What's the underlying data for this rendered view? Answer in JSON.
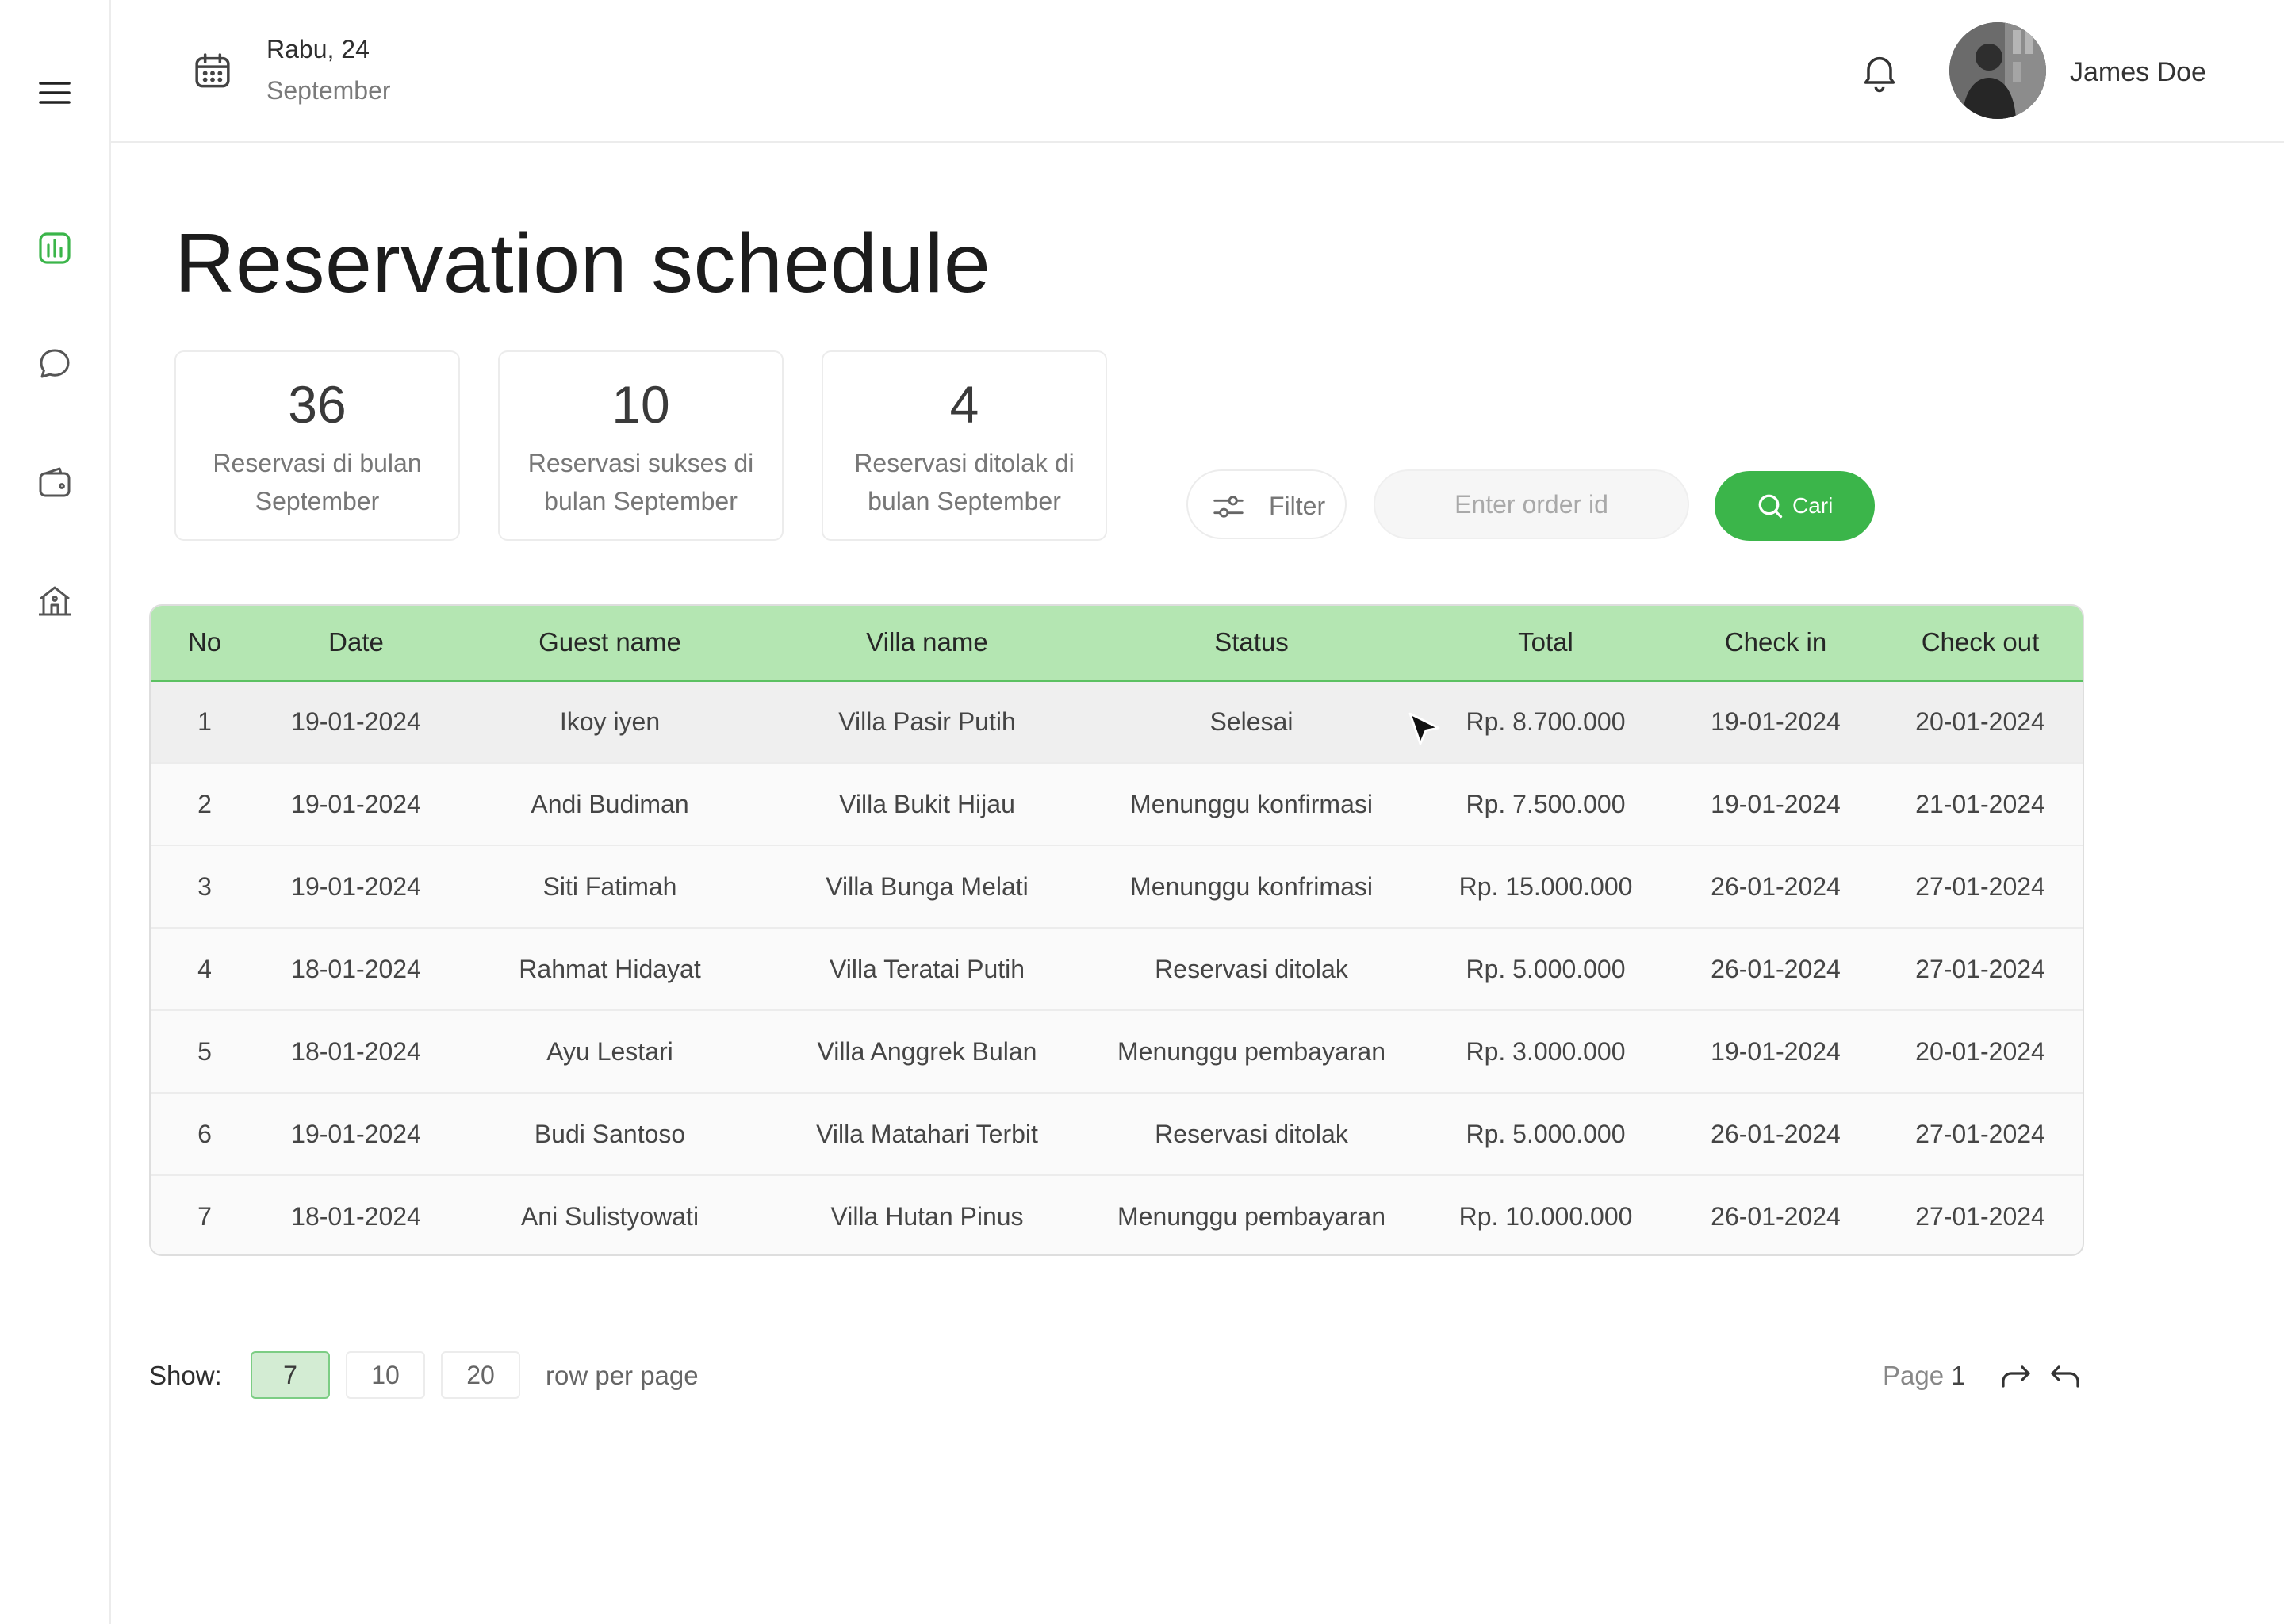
{
  "header": {
    "date_day": "Rabu, 24",
    "date_month": "September",
    "user_name": "James Doe"
  },
  "sidebar": {
    "items": [
      {
        "icon": "menu-icon"
      },
      {
        "icon": "chart-icon",
        "active": true
      },
      {
        "icon": "chat-icon"
      },
      {
        "icon": "wallet-icon"
      },
      {
        "icon": "house-icon"
      }
    ]
  },
  "page": {
    "title": "Reservation schedule"
  },
  "stats": [
    {
      "value": "36",
      "label": "Reservasi di bulan September"
    },
    {
      "value": "10",
      "label": "Reservasi sukses di bulan September"
    },
    {
      "value": "4",
      "label": "Reservasi ditolak di bulan September"
    }
  ],
  "toolbar": {
    "filter_label": "Filter",
    "search_placeholder": "Enter order id",
    "search_label": "Cari"
  },
  "table": {
    "columns": [
      "No",
      "Date",
      "Guest name",
      "Villa name",
      "Status",
      "Total",
      "Check in",
      "Check out"
    ],
    "rows": [
      [
        "1",
        "19-01-2024",
        "Ikoy iyen",
        "Villa Pasir Putih",
        "Selesai",
        "Rp. 8.700.000",
        "19-01-2024",
        "20-01-2024"
      ],
      [
        "2",
        "19-01-2024",
        "Andi Budiman",
        "Villa Bukit Hijau",
        "Menunggu konfirmasi",
        "Rp. 7.500.000",
        "19-01-2024",
        "21-01-2024"
      ],
      [
        "3",
        "19-01-2024",
        "Siti Fatimah",
        "Villa Bunga Melati",
        "Menunggu konfrimasi",
        "Rp. 15.000.000",
        "26-01-2024",
        "27-01-2024"
      ],
      [
        "4",
        "18-01-2024",
        "Rahmat Hidayat",
        "Villa Teratai Putih",
        "Reservasi ditolak",
        "Rp. 5.000.000",
        "26-01-2024",
        "27-01-2024"
      ],
      [
        "5",
        "18-01-2024",
        "Ayu Lestari",
        "Villa Anggrek Bulan",
        "Menunggu pembayaran",
        "Rp. 3.000.000",
        "19-01-2024",
        "20-01-2024"
      ],
      [
        "6",
        "19-01-2024",
        "Budi Santoso",
        "Villa Matahari Terbit",
        "Reservasi ditolak",
        "Rp. 5.000.000",
        "26-01-2024",
        "27-01-2024"
      ],
      [
        "7",
        "18-01-2024",
        "Ani Sulistyowati",
        "Villa Hutan Pinus",
        "Menunggu pembayaran",
        "Rp. 10.000.000",
        "26-01-2024",
        "27-01-2024"
      ]
    ]
  },
  "pagination": {
    "show_label": "Show:",
    "options": [
      "7",
      "10",
      "20"
    ],
    "selected": "7",
    "rows_text": "row per page",
    "page_label": "Page",
    "page_number": "1"
  },
  "colors": {
    "accent": "#3bb54a",
    "header_row": "#b4e6b2",
    "active_option": "#d3ecd3"
  }
}
